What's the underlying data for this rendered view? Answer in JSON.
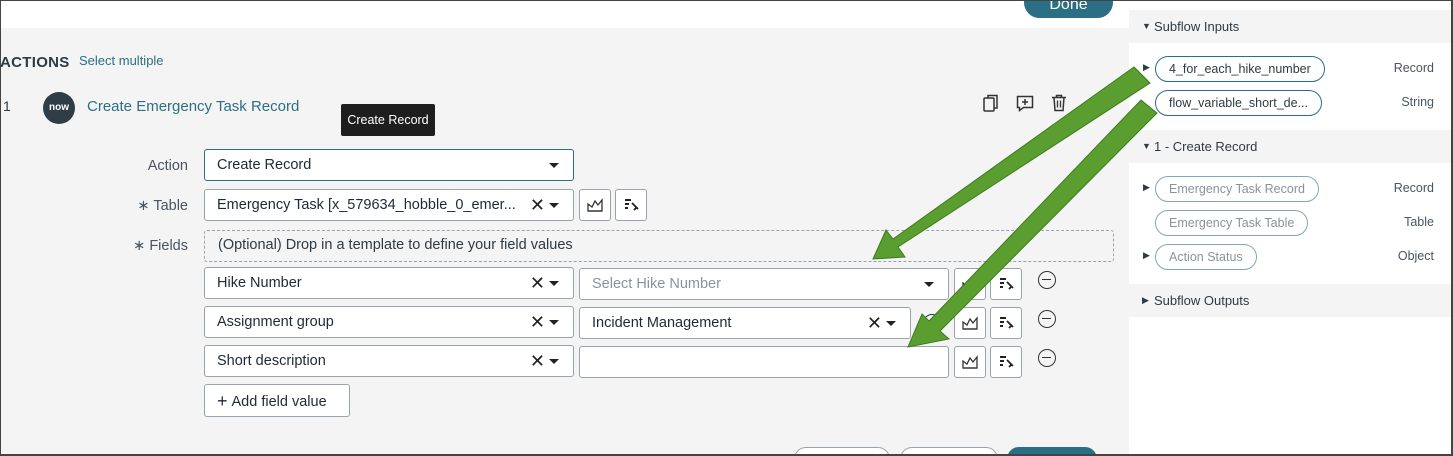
{
  "toolbar": {
    "done_label": "Done"
  },
  "actions_header": {
    "title": "ACTIONS",
    "select_multiple": "Select multiple"
  },
  "action": {
    "number": "1",
    "logo": "now",
    "title": "Create Emergency Task Record",
    "tooltip": "Create Record",
    "icons": [
      "copy-icon",
      "add-comment-icon",
      "trash-icon"
    ]
  },
  "form": {
    "action_label": "Action",
    "action_value": "Create Record",
    "table_label": "∗ Table",
    "table_value": "Emergency Task [x_579634_hobble_0_emer...",
    "fields_label": "∗ Fields",
    "dropzone_text": "(Optional) Drop in a template to define your field values",
    "rows": [
      {
        "field": "Hike Number",
        "value": "",
        "placeholder": "Select Hike Number"
      },
      {
        "field": "Assignment group",
        "value": "Incident Management",
        "placeholder": ""
      },
      {
        "field": "Short description",
        "value": "",
        "placeholder": ""
      }
    ],
    "add_field_label": "Add field value"
  },
  "panel": {
    "subflow_inputs": {
      "title": "Subflow Inputs",
      "items": [
        {
          "label": "4_for_each_hike_number",
          "type": "Record"
        },
        {
          "label": "flow_variable_short_de...",
          "type": "String"
        }
      ]
    },
    "create_record": {
      "title": "1 - Create Record",
      "items": [
        {
          "label": "Emergency Task Record",
          "type": "Record"
        },
        {
          "label": "Emergency Task Table",
          "type": "Table"
        },
        {
          "label": "Action Status",
          "type": "Object"
        }
      ]
    },
    "subflow_outputs": {
      "title": "Subflow Outputs"
    }
  },
  "colors": {
    "accent": "#2b6f84",
    "arrow": "#5a9e2f",
    "tooltip_bg": "#1e1e1e"
  }
}
